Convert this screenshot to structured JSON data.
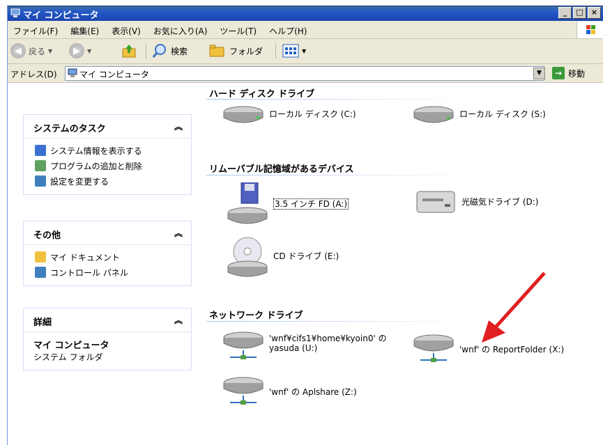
{
  "window": {
    "title": "マイ コンピュータ"
  },
  "menu": [
    "ファイル(F)",
    "編集(E)",
    "表示(V)",
    "お気に入り(A)",
    "ツール(T)",
    "ヘルプ(H)"
  ],
  "toolbar": {
    "back": "戻る",
    "search": "検索",
    "folders": "フォルダ"
  },
  "address": {
    "label": "アドレス(D)",
    "value": "マイ コンピュータ",
    "go": "移動"
  },
  "left": {
    "system_tasks": {
      "title": "システムのタスク",
      "items": [
        "システム情報を表示する",
        "プログラムの追加と削除",
        "設定を変更する"
      ]
    },
    "other": {
      "title": "その他",
      "items": [
        "マイ ドキュメント",
        "コントロール パネル"
      ]
    },
    "details": {
      "title": "詳細",
      "name": "マイ コンピュータ",
      "type": "システム フォルダ"
    }
  },
  "groups": {
    "hdd": {
      "title": "ハード ディスク ドライブ",
      "items": [
        "ローカル ディスク (C:)",
        "ローカル ディスク (S:)"
      ]
    },
    "removable": {
      "title": "リムーバブル記憶域があるデバイス",
      "items": [
        "3.5 インチ FD (A:)",
        "光磁気ドライブ (D:)",
        "CD ドライブ (E:)"
      ]
    },
    "network": {
      "title": "ネットワーク ドライブ",
      "items": [
        "'wnf¥cifs1¥home¥kyoin0' の",
        "yasuda (U:)",
        "'wnf' の ReportFolder (X:)",
        "'wnf' の Aplshare (Z:)"
      ]
    }
  },
  "colors": {
    "arrow": "#e02020",
    "titlebar": "#2458c8"
  }
}
